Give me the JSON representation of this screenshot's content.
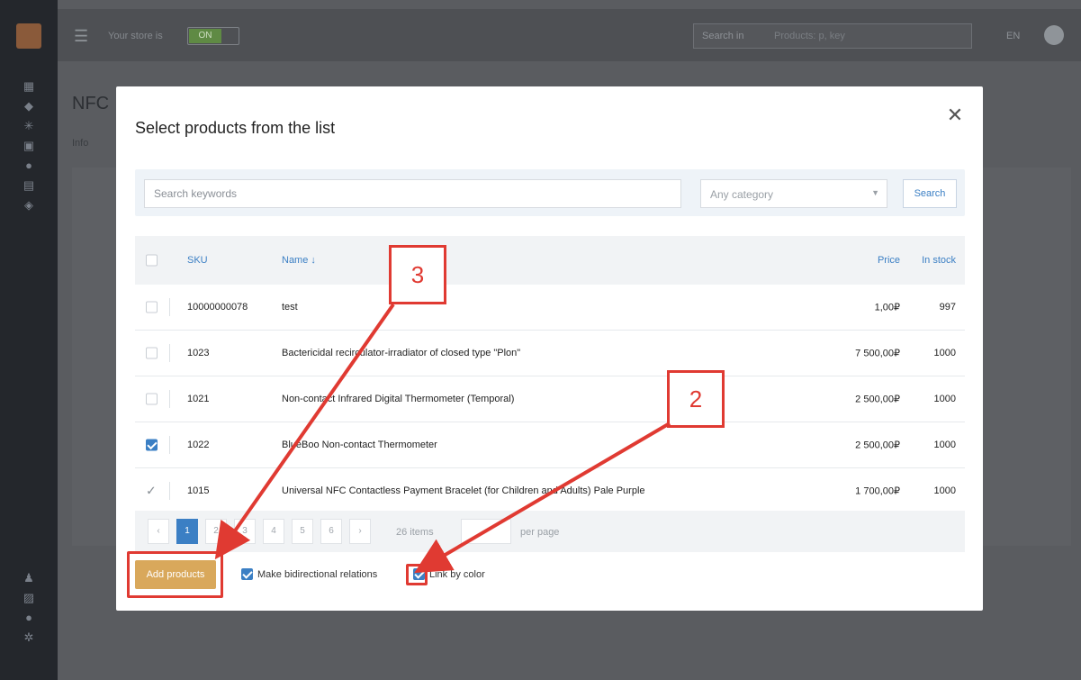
{
  "background": {
    "store_label": "Your store is",
    "store_toggle": "ON",
    "search_in": "Search in",
    "search_placeholder": "Products: p, key",
    "lang": "EN",
    "page_title": "NFC",
    "tab_info": "Info"
  },
  "modal": {
    "title": "Select products from the list",
    "search_placeholder": "Search keywords",
    "category": "Any category",
    "search_button": "Search",
    "columns": {
      "sku": "SKU",
      "name": "Name ↓",
      "price": "Price",
      "stock": "In stock"
    },
    "rows": [
      {
        "sku": "10000000078",
        "name": "test",
        "price": "1,00₽",
        "stock": "997",
        "state": "unchecked"
      },
      {
        "sku": "1023",
        "name": "Bactericidal recirculator-irradiator of closed type \"Plon\"",
        "price": "7 500,00₽",
        "stock": "1000",
        "state": "unchecked"
      },
      {
        "sku": "1021",
        "name": "Non-contact Infrared Digital Thermometer (Temporal)",
        "price": "2 500,00₽",
        "stock": "1000",
        "state": "unchecked"
      },
      {
        "sku": "1022",
        "name": "BlueBoo Non-contact Thermometer",
        "price": "2 500,00₽",
        "stock": "1000",
        "state": "checked"
      },
      {
        "sku": "1015",
        "name": "Universal NFC Contactless Payment Bracelet (for Children and Adults) Pale Purple",
        "price": "1 700,00₽",
        "stock": "1000",
        "state": "added"
      }
    ],
    "pager": {
      "prev": "‹",
      "pages": [
        "1",
        "2",
        "3",
        "4",
        "5",
        "6"
      ],
      "next": "›",
      "items": "26 items",
      "per_page": "per page"
    },
    "add_button": "Add products",
    "bidirectional_label": "Make bidirectional relations",
    "link_color_label": "Link by color"
  },
  "annotations": {
    "step2": "2",
    "step3": "3"
  },
  "colors": {
    "accent": "#3b7fc4",
    "add_button": "#d9a85b",
    "annotation": "#e03a32"
  }
}
